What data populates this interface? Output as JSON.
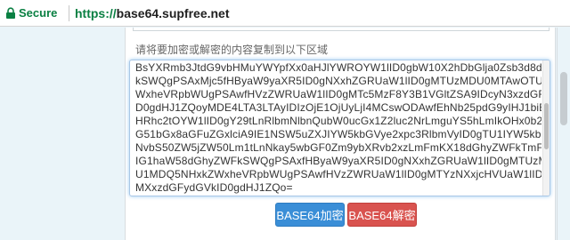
{
  "browser": {
    "secure_label": "Secure",
    "url_scheme": "https://",
    "url_host": "base64.supfree.net",
    "secure_color": "#0b8043"
  },
  "form": {
    "prompt": "请将要加密或解密的内容复制到以下区域",
    "text_lines": [
      "BsYXRmb3JtdG9vbHMuYWYpfXx0aHJlYWROYW1lID0gbW10X2hDbGlja0Zsb3d8dGhyZWF",
      "kSWQgPSAxMjc5fHByaW9yaXR5ID0gNXxhZGRUaW1lID0gMTUzMDU0MTAwOTU1OHxkZ",
      "WxheVRpbWUgPSAwfHVzZWRUaW1lID0gMTc5MzF8Y3B1VGltZSA9IDcyN3xzdGFydGVkI",
      "D0gdHJ1ZQoyMDE4LTA3LTAyIDIzOjE1OjUyLjI4MCswODAwfEhNb25pdG9yIHJ1biB0YXNrf",
      "HRhc2tOYW1lID0gY29tLnRlbmNlbnQubW0ucGx1Z2luc2NrLmguYS5hLmIkOHx0b2tlbiA9I",
      "G51bGx8aGFuZGxlciA9IE1NSW5uZXJIYW5kbGVye2xpc3RlbmVyID0gTU1IYW5kbGVyKG",
      "NvbS50ZW5jZW50Lm1tLnNkay5wbGF0Zm9ybXRvb2xzLmFmKX18dGhyZWFkTmFtZSA9",
      "IG1haW58dGhyZWFkSWQgPSAxfHByaW9yaXR5ID0gNXxhZGRUaW1lID0gMTUzMDU0ND",
      "U1MDQ5NHxkZWxheVRpbWUgPSAwfHVzZWRUaW1lID0gMTYzNXxjcHVUaW1lID0gMTYx",
      "MXxzdGFydGVkID0gdHJ1ZQo="
    ],
    "encode_button": "BASE64加密",
    "decode_button": "BASE64解密",
    "encode_color": "#3a8ed7",
    "decode_color": "#d9534f"
  }
}
